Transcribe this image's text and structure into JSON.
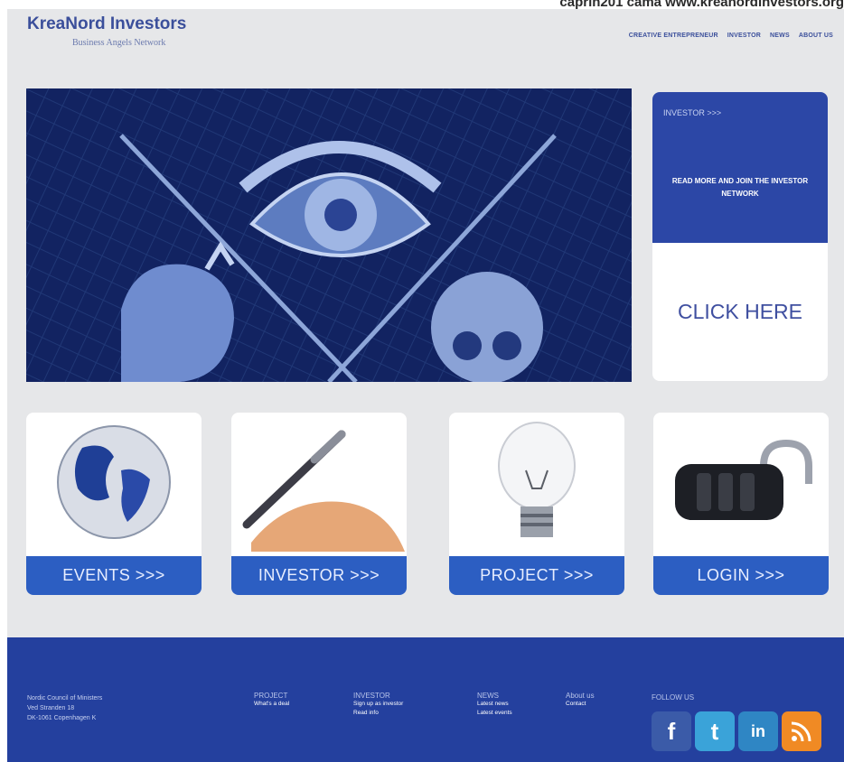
{
  "top_note": "caprin201 cama www.kreanordinvestors.org",
  "brand": {
    "title": "KreaNord Investors",
    "subtitle": "Business Angels Network"
  },
  "nav": [
    "CREATIVE ENTREPRENEUR",
    "INVESTOR",
    "NEWS",
    "ABOUT US"
  ],
  "side_panel": {
    "heading": "INVESTOR >>>",
    "text": "READ MORE AND JOIN THE INVESTOR NETWORK",
    "cta": "CLICK HERE"
  },
  "tiles": [
    {
      "label": "EVENTS >>>",
      "icon": "globe-icon"
    },
    {
      "label": "INVESTOR >>>",
      "icon": "pen-hand-icon"
    },
    {
      "label": "PROJECT >>>",
      "icon": "lightbulb-icon"
    },
    {
      "label": "LOGIN >>>",
      "icon": "padlock-icon"
    }
  ],
  "footer": {
    "address": [
      "Nordic Council of Ministers",
      "Ved Stranden 18",
      "DK-1061 Copenhagen K"
    ],
    "columns": [
      {
        "heading": "PROJECT",
        "links": [
          "What's a deal"
        ]
      },
      {
        "heading": "INVESTOR",
        "links": [
          "Sign up as investor",
          "Read info"
        ]
      },
      {
        "heading": "NEWS",
        "links": [
          "Latest news",
          "Latest events"
        ]
      },
      {
        "heading": "About us",
        "links": [
          "Contact"
        ]
      }
    ],
    "follow_heading": "FOLLOW US",
    "social": [
      {
        "name": "facebook-icon",
        "glyph": "f",
        "color": "#3b5ba8"
      },
      {
        "name": "twitter-icon",
        "glyph": "t",
        "color": "#3aa3d9"
      },
      {
        "name": "linkedin-icon",
        "glyph": "in",
        "color": "#2f86c4"
      },
      {
        "name": "rss-icon",
        "glyph": "",
        "color": "#f08a24"
      }
    ]
  }
}
